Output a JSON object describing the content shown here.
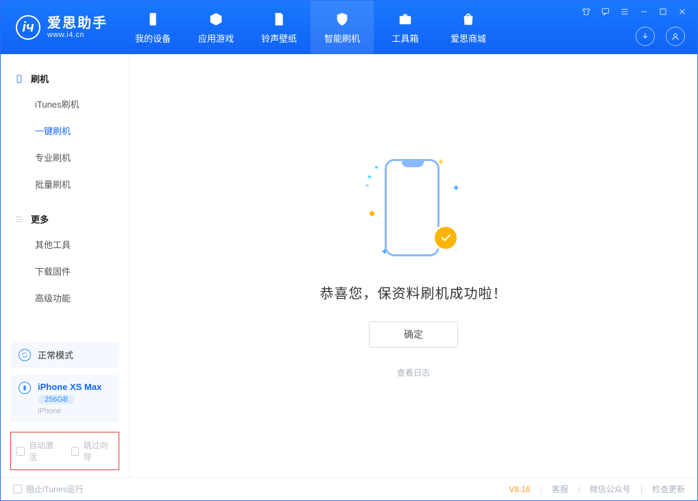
{
  "app": {
    "name_cn": "爱思助手",
    "name_en": "www.i4.cn"
  },
  "tabs": {
    "device": "我的设备",
    "apps": "应用游戏",
    "ring": "铃声壁纸",
    "flash": "智能刷机",
    "toolbox": "工具箱",
    "store": "爱思商城"
  },
  "sidebar": {
    "section_flash": "刷机",
    "section_more": "更多",
    "items": {
      "itunes": "iTunes刷机",
      "oneclick": "一键刷机",
      "pro": "专业刷机",
      "batch": "批量刷机",
      "other": "其他工具",
      "firmware": "下载固件",
      "advanced": "高级功能"
    }
  },
  "device_panel": {
    "mode": "正常模式",
    "name": "iPhone XS Max",
    "storage": "256GB",
    "type": "iPhone"
  },
  "options": {
    "auto_activate": "自动激活",
    "skip_guide": "跳过向导"
  },
  "main": {
    "success_title": "恭喜您，保资料刷机成功啦！",
    "ok": "确定",
    "view_log": "查看日志"
  },
  "status": {
    "block_itunes": "阻止iTunes运行",
    "version": "V8.16",
    "support": "客服",
    "wechat": "微信公众号",
    "update": "检查更新"
  }
}
